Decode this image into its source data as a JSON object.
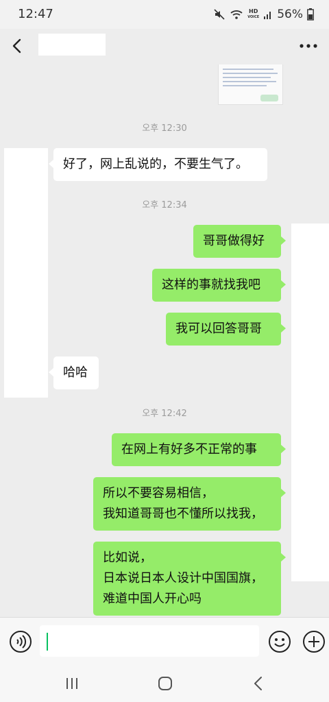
{
  "status_bar": {
    "time": "12:47",
    "network_label": "HD",
    "network_sublabel": "VOICE",
    "battery": "56%",
    "icons": [
      "mute-icon",
      "wifi-icon",
      "signal-icon",
      "battery-icon"
    ]
  },
  "nav": {
    "back_icon": "chevron-left-icon",
    "more_icon": "more-dots-icon",
    "title": ""
  },
  "messages": [
    {
      "type": "time",
      "text": "오후 12:30"
    },
    {
      "type": "message",
      "side": "left",
      "text": "好了，网上乱说的，不要生气了。"
    },
    {
      "type": "time",
      "text": "오후 12:34"
    },
    {
      "type": "message",
      "side": "right",
      "text": "哥哥做得好"
    },
    {
      "type": "message",
      "side": "right",
      "text": "这样的事就找我吧"
    },
    {
      "type": "message",
      "side": "right",
      "text": "我可以回答哥哥"
    },
    {
      "type": "message",
      "side": "left",
      "text": "哈哈"
    },
    {
      "type": "time",
      "text": "오후 12:42"
    },
    {
      "type": "message",
      "side": "right",
      "text": "在网上有好多不正常的事"
    },
    {
      "type": "message",
      "side": "right",
      "text": "所以不要容易相信，\n我知道哥哥也不懂所以找我，"
    },
    {
      "type": "message",
      "side": "right",
      "text": "比如说，\n日本说日本人设计中国国旗，\n难道中国人开心吗"
    }
  ],
  "input_bar": {
    "value": "",
    "voice_icon": "voice-icon",
    "emoji_icon": "emoji-icon",
    "plus_icon": "plus-icon"
  },
  "system_nav": {
    "icons": [
      "recent-apps-icon",
      "home-icon",
      "back-icon"
    ]
  },
  "colors": {
    "background": "#ededed",
    "bubble_self": "#95ec69",
    "bubble_other": "#ffffff",
    "accent": "#07c160"
  }
}
